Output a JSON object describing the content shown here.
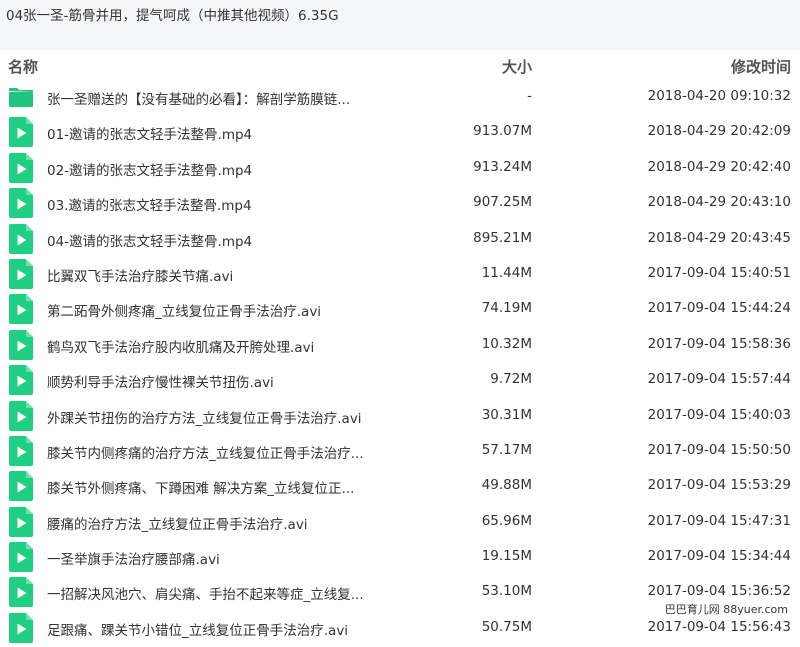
{
  "window": {
    "title": "04张一圣-筋骨并用，提气呵成（中推其他视频）6.35G"
  },
  "columns": {
    "name": "名称",
    "size": "大小",
    "modified": "修改时间"
  },
  "colors": {
    "accent": "#1fcf82",
    "folder": "#21c47d"
  },
  "files": [
    {
      "icon": "folder-icon",
      "name": "张一圣赠送的【没有基础的必看】：解剖学筋膜链...",
      "size": "-",
      "modified": "2018-04-20 09:10:32"
    },
    {
      "icon": "video-file-icon",
      "name": "01-邀请的张志文轻手法整骨.mp4",
      "size": "913.07M",
      "modified": "2018-04-29 20:42:09"
    },
    {
      "icon": "video-file-icon",
      "name": "02-邀请的张志文轻手法整骨.mp4",
      "size": "913.24M",
      "modified": "2018-04-29 20:42:40"
    },
    {
      "icon": "video-file-icon",
      "name": "03.邀请的张志文轻手法整骨.mp4",
      "size": "907.25M",
      "modified": "2018-04-29 20:43:10"
    },
    {
      "icon": "video-file-icon",
      "name": "04-邀请的张志文轻手法整骨.mp4",
      "size": "895.21M",
      "modified": "2018-04-29 20:43:45"
    },
    {
      "icon": "video-file-icon",
      "name": "比翼双飞手法治疗膝关节痛.avi",
      "size": "11.44M",
      "modified": "2017-09-04 15:40:51"
    },
    {
      "icon": "video-file-icon",
      "name": "第二跖骨外侧疼痛_立线复位正骨手法治疗.avi",
      "size": "74.19M",
      "modified": "2017-09-04 15:44:24"
    },
    {
      "icon": "video-file-icon",
      "name": "鹤鸟双飞手法治疗股内收肌痛及开胯处理.avi",
      "size": "10.32M",
      "modified": "2017-09-04 15:58:36"
    },
    {
      "icon": "video-file-icon",
      "name": "顺势利导手法治疗慢性裸关节扭伤.avi",
      "size": "9.72M",
      "modified": "2017-09-04 15:57:44"
    },
    {
      "icon": "video-file-icon",
      "name": "外踝关节扭伤的治疗方法_立线复位正骨手法治疗.avi",
      "size": "30.31M",
      "modified": "2017-09-04 15:40:03"
    },
    {
      "icon": "video-file-icon",
      "name": "膝关节内侧疼痛的治疗方法_立线复位正骨手法治疗...",
      "size": "57.17M",
      "modified": "2017-09-04 15:50:50"
    },
    {
      "icon": "video-file-icon",
      "name": "膝关节外侧疼痛、下蹲困难 解决方案_立线复位正...",
      "size": "49.88M",
      "modified": "2017-09-04 15:53:29"
    },
    {
      "icon": "video-file-icon",
      "name": "腰痛的治疗方法_立线复位正骨手法治疗.avi",
      "size": "65.96M",
      "modified": "2017-09-04 15:47:31"
    },
    {
      "icon": "video-file-icon",
      "name": "一圣举旗手法治疗腰部痛.avi",
      "size": "19.15M",
      "modified": "2017-09-04 15:34:44"
    },
    {
      "icon": "video-file-icon",
      "name": "一招解决风池穴、肩尖痛、手抬不起来等症_立线复...",
      "size": "53.10M",
      "modified": "2017-09-04 15:36:52"
    },
    {
      "icon": "video-file-icon",
      "name": "足跟痛、踝关节小错位_立线复位正骨手法治疗.avi",
      "size": "50.75M",
      "modified": "2017-09-04 15:56:43"
    }
  ],
  "watermark": "巴巴育儿网 88yuer.com"
}
